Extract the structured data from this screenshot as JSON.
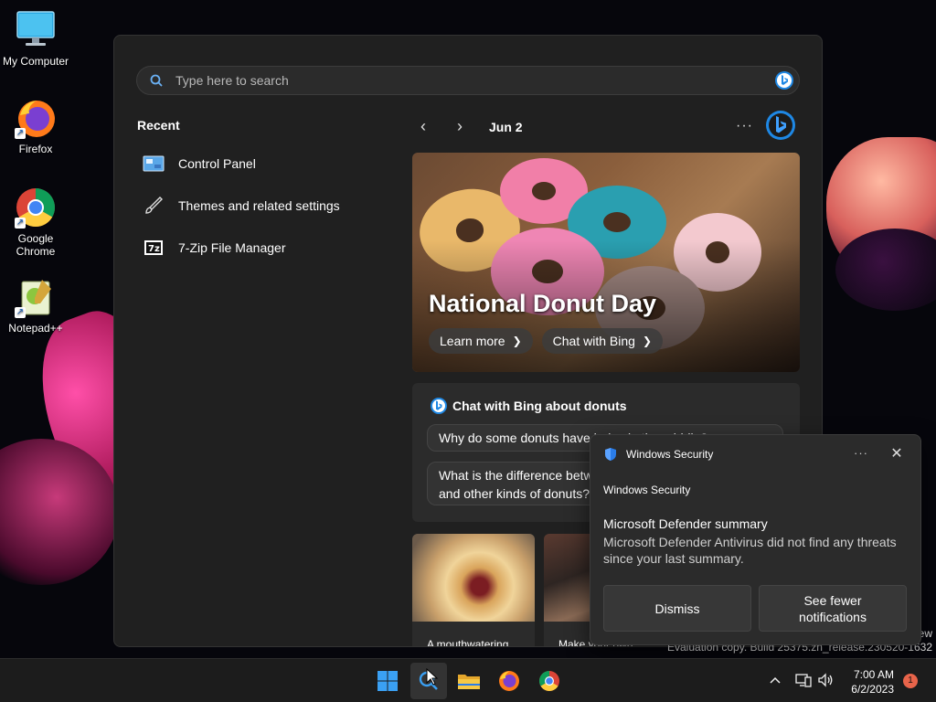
{
  "desktop": {
    "icons": [
      {
        "label": "My Computer"
      },
      {
        "label": "Firefox"
      },
      {
        "label": "Google Chrome"
      },
      {
        "label": "Notepad++"
      }
    ]
  },
  "search": {
    "placeholder": "Type here to search"
  },
  "recent": {
    "title": "Recent",
    "items": [
      {
        "label": "Control Panel"
      },
      {
        "label": "Themes and related settings"
      },
      {
        "label": "7-Zip File Manager"
      }
    ]
  },
  "highlights": {
    "date": "Jun 2",
    "more": "···",
    "hero": {
      "title": "National Donut Day",
      "learn_more": "Learn more",
      "chat_with_bing": "Chat with Bing"
    },
    "chat_card": {
      "title": "Chat with Bing about donuts",
      "q1": "Why do some donuts have holes in the middle?",
      "q2_line1": "What is the difference between",
      "q2_line2": "and other kinds of donuts?"
    },
    "thumbs": [
      {
        "caption": "A mouthwatering"
      },
      {
        "caption": "Make your own"
      }
    ]
  },
  "toast": {
    "app": "Windows Security",
    "app_sub": "Windows Security",
    "more": "···",
    "title": "Microsoft Defender summary",
    "body": "Microsoft Defender Antivirus did not find any threats since your last summary.",
    "dismiss": "Dismiss",
    "fewer_line1": "See fewer",
    "fewer_line2": "notifications"
  },
  "watermark": {
    "line1": "ew",
    "line2": "Evaluation copy. Build 25375.zn_release.230520-1632"
  },
  "taskbar": {
    "time": "7:00 AM",
    "date": "6/2/2023",
    "notifications": "1"
  },
  "colors": {
    "panel_bg": "#202020",
    "card_bg": "#2b2b2b",
    "taskbar_bg": "#1c1c1c",
    "bing_blue": "#1e88e5",
    "badge": "#e8644a"
  }
}
